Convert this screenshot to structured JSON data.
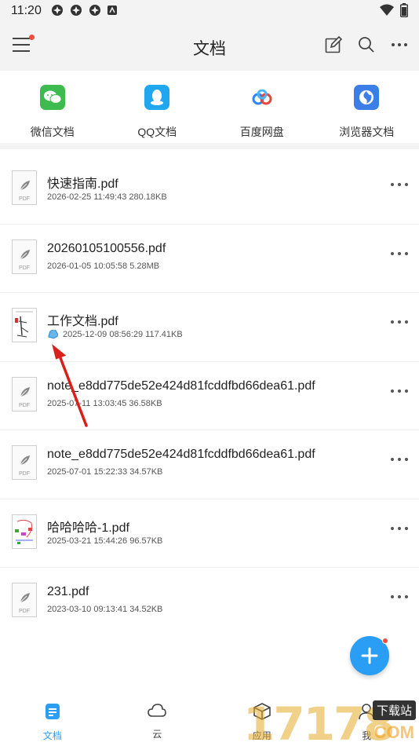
{
  "status_bar": {
    "time": "11:20"
  },
  "app_bar": {
    "title": "文档"
  },
  "sources": [
    {
      "label": "微信文档",
      "icon": "wechat-icon",
      "color": "#3ebb4f"
    },
    {
      "label": "QQ文档",
      "icon": "qq-icon",
      "color": "#20a7f0"
    },
    {
      "label": "百度网盘",
      "icon": "baidu-netdisk-icon",
      "color": "#2e86f5"
    },
    {
      "label": "浏览器文档",
      "icon": "browser-icon",
      "color": "#3c7ee8"
    }
  ],
  "files": [
    {
      "name": "快速指南.pdf",
      "meta": "2026-02-25 11:49:43 280.18KB",
      "thumb": "pdf-leaf"
    },
    {
      "name": "20260105100556.pdf",
      "meta": "2026-01-05 10:05:58 5.28MB",
      "thumb": "pdf-leaf"
    },
    {
      "name": "工作文档.pdf",
      "meta": "2025-12-09 08:56:29 117.41KB",
      "thumb": "document-preview",
      "tagged": true
    },
    {
      "name": "note_e8dd775de52e424d81fcddfbd66dea61.pdf",
      "meta": "2025-07-11 13:03:45 36.58KB",
      "thumb": "pdf-leaf"
    },
    {
      "name": "note_e8dd775de52e424d81fcddfbd66dea61.pdf",
      "meta": "2025-07-01 15:22:33 34.57KB",
      "thumb": "pdf-leaf"
    },
    {
      "name": "哈哈哈哈-1.pdf",
      "meta": "2025-03-21 15:44:26 96.57KB",
      "thumb": "document-preview"
    },
    {
      "name": "231.pdf",
      "meta": "2023-03-10 09:13:41 34.52KB",
      "thumb": "pdf-leaf"
    }
  ],
  "thumb_tag": "PDF",
  "bottom_nav": [
    {
      "label": "文档",
      "icon": "document-icon",
      "active": true
    },
    {
      "label": "云",
      "icon": "cloud-icon",
      "active": false
    },
    {
      "label": "应用",
      "icon": "apps-icon",
      "active": false
    },
    {
      "label": "我",
      "icon": "user-icon",
      "active": false
    }
  ],
  "watermark": {
    "number": "17178",
    "label": "下载站",
    "sub": "COM"
  },
  "colors": {
    "accent": "#2a9df4",
    "badge": "#f24a3b",
    "arrow": "#d9201c"
  }
}
